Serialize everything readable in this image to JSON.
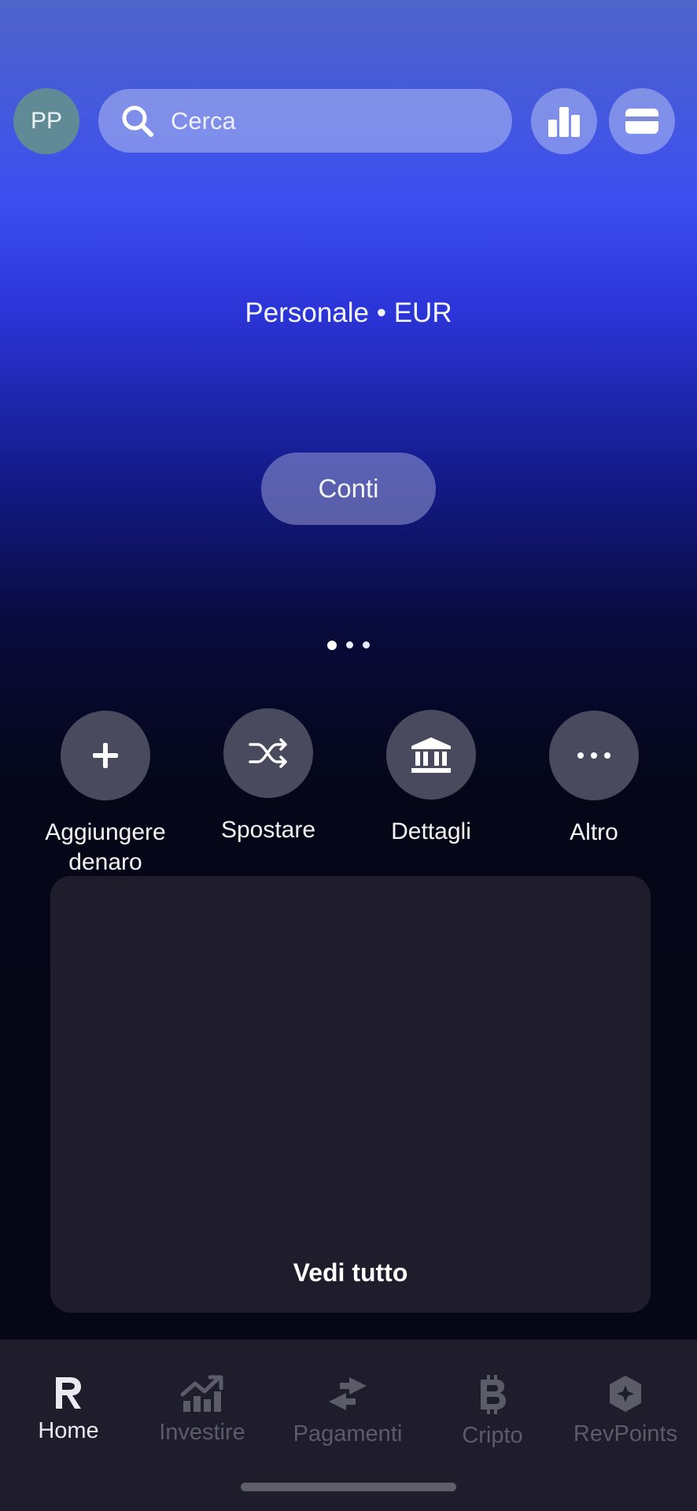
{
  "header": {
    "avatar_initials": "PP",
    "search_placeholder": "Cerca",
    "icons": [
      "search-icon",
      "bar-chart-icon",
      "card-icon"
    ]
  },
  "account": {
    "label": "Personale • EUR",
    "accounts_button": "Conti",
    "pager": {
      "count": 3,
      "active": 0
    }
  },
  "actions": [
    {
      "label": "Aggiungere denaro",
      "icon": "plus-icon"
    },
    {
      "label": "Spostare",
      "icon": "shuffle-icon"
    },
    {
      "label": "Dettagli",
      "icon": "bank-icon"
    },
    {
      "label": "Altro",
      "icon": "more-icon"
    }
  ],
  "card": {
    "see_all_label": "Vedi tutto"
  },
  "nav": [
    {
      "label": "Home",
      "icon": "revolut-logo-icon",
      "active": true
    },
    {
      "label": "Investire",
      "icon": "stocks-icon",
      "active": false
    },
    {
      "label": "Pagamenti",
      "icon": "transfer-arrows-icon",
      "active": false
    },
    {
      "label": "Cripto",
      "icon": "bitcoin-icon",
      "active": false
    },
    {
      "label": "RevPoints",
      "icon": "revpoints-icon",
      "active": false
    }
  ],
  "colors": {
    "nav_active": "#e9e9ef",
    "nav_inactive": "#5c5b68",
    "card_bg": "#1f1d2c",
    "action_circle": "#4a4a5e"
  }
}
